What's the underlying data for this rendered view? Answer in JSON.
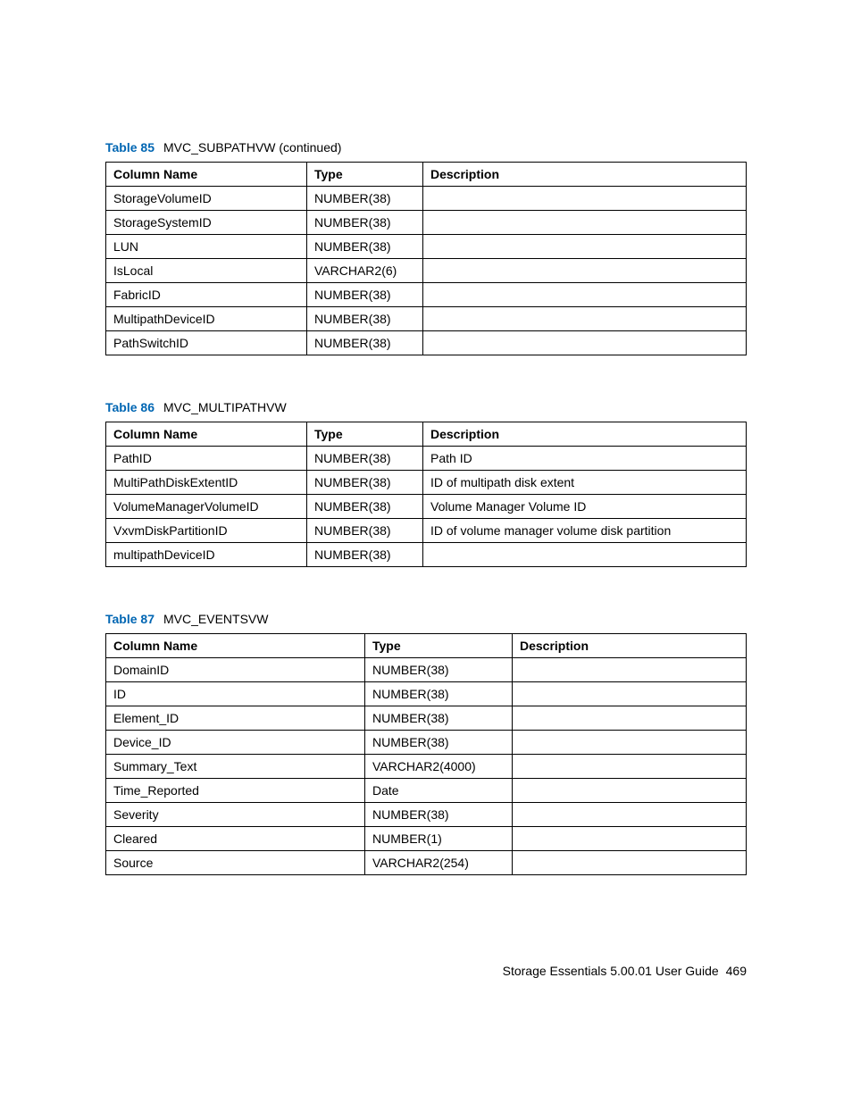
{
  "tables": [
    {
      "label": "Table 85",
      "title": "MVC_SUBPATHVW (continued)",
      "cls": "t85",
      "headers": [
        "Column Name",
        "Type",
        "Description"
      ],
      "rows": [
        [
          "StorageVolumeID",
          "NUMBER(38)",
          ""
        ],
        [
          "StorageSystemID",
          "NUMBER(38)",
          ""
        ],
        [
          "LUN",
          "NUMBER(38)",
          ""
        ],
        [
          "IsLocal",
          "VARCHAR2(6)",
          ""
        ],
        [
          "FabricID",
          "NUMBER(38)",
          ""
        ],
        [
          "MultipathDeviceID",
          "NUMBER(38)",
          ""
        ],
        [
          "PathSwitchID",
          "NUMBER(38)",
          ""
        ]
      ]
    },
    {
      "label": "Table 86",
      "title": "MVC_MULTIPATHVW",
      "cls": "t86",
      "headers": [
        "Column Name",
        "Type",
        "Description"
      ],
      "rows": [
        [
          "PathID",
          "NUMBER(38)",
          "Path ID"
        ],
        [
          "MultiPathDiskExtentID",
          "NUMBER(38)",
          "ID of multipath disk extent"
        ],
        [
          "VolumeManagerVolumeID",
          "NUMBER(38)",
          "Volume Manager Volume ID"
        ],
        [
          "VxvmDiskPartitionID",
          "NUMBER(38)",
          "ID of volume manager volume disk partition"
        ],
        [
          "multipathDeviceID",
          "NUMBER(38)",
          ""
        ]
      ]
    },
    {
      "label": "Table 87",
      "title": "MVC_EVENTSVW",
      "cls": "t87",
      "headers": [
        "Column Name",
        "Type",
        "Description"
      ],
      "rows": [
        [
          "DomainID",
          "NUMBER(38)",
          ""
        ],
        [
          "ID",
          "NUMBER(38)",
          ""
        ],
        [
          "Element_ID",
          "NUMBER(38)",
          ""
        ],
        [
          "Device_ID",
          "NUMBER(38)",
          ""
        ],
        [
          "Summary_Text",
          "VARCHAR2(4000)",
          ""
        ],
        [
          "Time_Reported",
          "Date",
          ""
        ],
        [
          "Severity",
          "NUMBER(38)",
          ""
        ],
        [
          "Cleared",
          "NUMBER(1)",
          ""
        ],
        [
          "Source",
          "VARCHAR2(254)",
          ""
        ]
      ]
    }
  ],
  "footer": {
    "text": "Storage Essentials 5.00.01 User Guide",
    "page": "469"
  },
  "chart_data": [
    {
      "type": "table",
      "title": "Table 85 MVC_SUBPATHVW (continued)",
      "columns": [
        "Column Name",
        "Type",
        "Description"
      ],
      "rows": [
        {
          "Column Name": "StorageVolumeID",
          "Type": "NUMBER(38)",
          "Description": ""
        },
        {
          "Column Name": "StorageSystemID",
          "Type": "NUMBER(38)",
          "Description": ""
        },
        {
          "Column Name": "LUN",
          "Type": "NUMBER(38)",
          "Description": ""
        },
        {
          "Column Name": "IsLocal",
          "Type": "VARCHAR2(6)",
          "Description": ""
        },
        {
          "Column Name": "FabricID",
          "Type": "NUMBER(38)",
          "Description": ""
        },
        {
          "Column Name": "MultipathDeviceID",
          "Type": "NUMBER(38)",
          "Description": ""
        },
        {
          "Column Name": "PathSwitchID",
          "Type": "NUMBER(38)",
          "Description": ""
        }
      ]
    },
    {
      "type": "table",
      "title": "Table 86 MVC_MULTIPATHVW",
      "columns": [
        "Column Name",
        "Type",
        "Description"
      ],
      "rows": [
        {
          "Column Name": "PathID",
          "Type": "NUMBER(38)",
          "Description": "Path ID"
        },
        {
          "Column Name": "MultiPathDiskExtentID",
          "Type": "NUMBER(38)",
          "Description": "ID of multipath disk extent"
        },
        {
          "Column Name": "VolumeManagerVolumeID",
          "Type": "NUMBER(38)",
          "Description": "Volume Manager Volume ID"
        },
        {
          "Column Name": "VxvmDiskPartitionID",
          "Type": "NUMBER(38)",
          "Description": "ID of volume manager volume disk partition"
        },
        {
          "Column Name": "multipathDeviceID",
          "Type": "NUMBER(38)",
          "Description": ""
        }
      ]
    },
    {
      "type": "table",
      "title": "Table 87 MVC_EVENTSVW",
      "columns": [
        "Column Name",
        "Type",
        "Description"
      ],
      "rows": [
        {
          "Column Name": "DomainID",
          "Type": "NUMBER(38)",
          "Description": ""
        },
        {
          "Column Name": "ID",
          "Type": "NUMBER(38)",
          "Description": ""
        },
        {
          "Column Name": "Element_ID",
          "Type": "NUMBER(38)",
          "Description": ""
        },
        {
          "Column Name": "Device_ID",
          "Type": "NUMBER(38)",
          "Description": ""
        },
        {
          "Column Name": "Summary_Text",
          "Type": "VARCHAR2(4000)",
          "Description": ""
        },
        {
          "Column Name": "Time_Reported",
          "Type": "Date",
          "Description": ""
        },
        {
          "Column Name": "Severity",
          "Type": "NUMBER(38)",
          "Description": ""
        },
        {
          "Column Name": "Cleared",
          "Type": "NUMBER(1)",
          "Description": ""
        },
        {
          "Column Name": "Source",
          "Type": "VARCHAR2(254)",
          "Description": ""
        }
      ]
    }
  ]
}
